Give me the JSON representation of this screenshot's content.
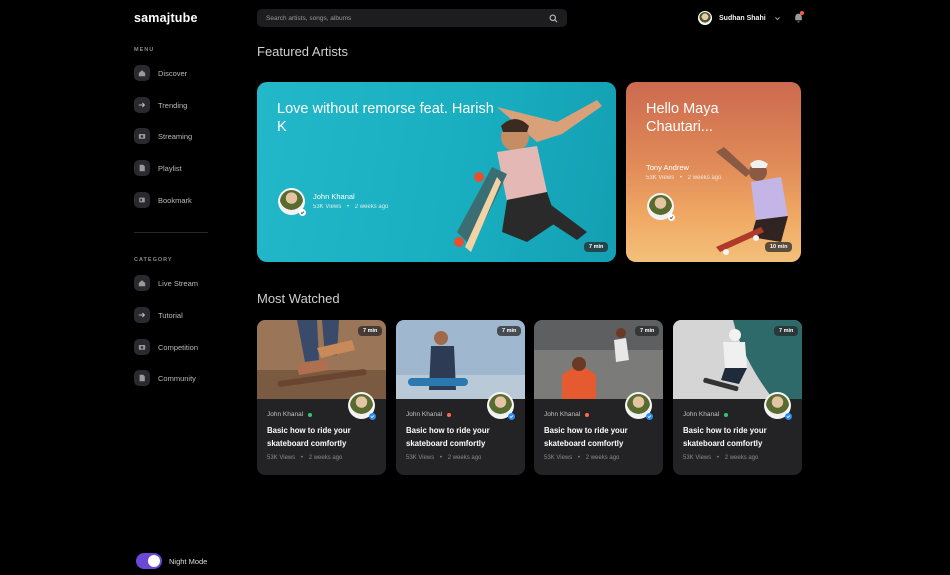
{
  "app": {
    "logo": "samajtube"
  },
  "search": {
    "placeholder": "Search artists, songs, albums"
  },
  "user": {
    "name": "Sudhan Shahi"
  },
  "sidebar": {
    "menu_title": "MENU",
    "menu": [
      {
        "label": "Discover",
        "icon": "home-icon"
      },
      {
        "label": "Trending",
        "icon": "arrow-right-icon"
      },
      {
        "label": "Streaming",
        "icon": "camera-icon"
      },
      {
        "label": "Playlist",
        "icon": "file-icon"
      },
      {
        "label": "Bookmark",
        "icon": "bookmark-icon"
      }
    ],
    "category_title": "CATEGORY",
    "category": [
      {
        "label": "Live Stream",
        "icon": "home-icon"
      },
      {
        "label": "Tutorial",
        "icon": "arrow-right-icon"
      },
      {
        "label": "Competition",
        "icon": "camera-icon"
      },
      {
        "label": "Community",
        "icon": "file-icon"
      }
    ],
    "night_mode_label": "Night Mode",
    "night_mode_on": true
  },
  "featured": {
    "title": "Featured Artists",
    "items": [
      {
        "title": "Love without remorse feat. Harish K",
        "artist": "John Khanal",
        "views": "53K Views",
        "time": "2 weeks ago",
        "duration": "7 min"
      },
      {
        "title": "Hello Maya Chautari...",
        "artist": "Tony Andrew",
        "views": "53K Views",
        "time": "2 weeks ago",
        "duration": "10 min"
      }
    ]
  },
  "most_watched": {
    "title": "Most Watched",
    "items": [
      {
        "author": "John Khanal",
        "status_color": "#2ecc71",
        "title": "Basic how to ride your skateboard comfortly",
        "views": "53K Views",
        "time": "2 weeks ago",
        "duration": "7 min"
      },
      {
        "author": "John Khanal",
        "status_color": "#ff6b4a",
        "title": "Basic how to ride your skateboard comfortly",
        "views": "53K Views",
        "time": "2 weeks ago",
        "duration": "7 min"
      },
      {
        "author": "John Khanal",
        "status_color": "#ff6b4a",
        "title": "Basic how to ride your skateboard comfortly",
        "views": "53K Views",
        "time": "2 weeks ago",
        "duration": "7 min"
      },
      {
        "author": "John Khanal",
        "status_color": "#2ecc71",
        "title": "Basic how to ride your skateboard comfortly",
        "views": "53K Views",
        "time": "2 weeks ago",
        "duration": "7 min"
      }
    ]
  },
  "colors": {
    "accent": "#6b48d6",
    "notification": "#ff5a3c"
  },
  "meta_separator": "•"
}
